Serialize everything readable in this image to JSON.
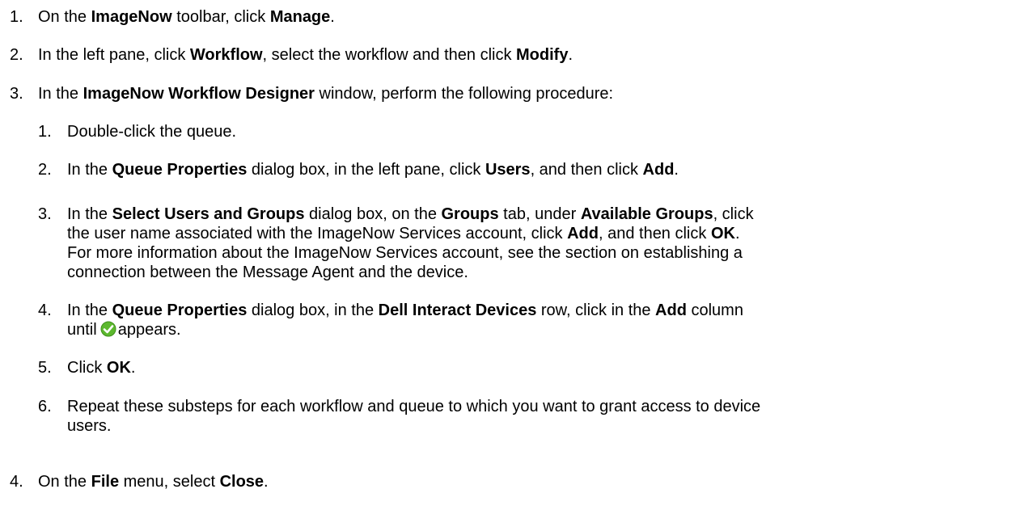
{
  "steps": [
    {
      "number": "1.",
      "parts": [
        "On the ",
        "ImageNow",
        " toolbar, click ",
        "Manage",
        "."
      ]
    },
    {
      "number": "2.",
      "parts": [
        "In the left pane, click ",
        "Workflow",
        ", select the workflow and then click ",
        "Modify",
        "."
      ]
    },
    {
      "number": "3.",
      "parts": [
        "In the ",
        "ImageNow Workflow Designer",
        " window, perform the following procedure:"
      ],
      "substeps": [
        {
          "number": "1.",
          "parts": [
            "Double-click the queue."
          ]
        },
        {
          "number": "2.",
          "parts": [
            "In the ",
            "Queue Properties",
            " dialog box, in the left pane, click ",
            "Users",
            ", and then click ",
            "Add",
            "."
          ]
        },
        {
          "number": "3.",
          "line1": [
            "In the ",
            "Select Users and Groups",
            " dialog box, on the ",
            "Groups",
            " tab, under ",
            "Available Groups",
            ", click"
          ],
          "line2": [
            "the user name associated with the ImageNow Services account, click ",
            "Add",
            ", and then click ",
            "OK",
            "."
          ],
          "line3": "For more information about the ImageNow Services account, see the section on establishing a",
          "line4": "connection between the Message Agent and the device."
        },
        {
          "number": "4.",
          "line1": [
            "In the ",
            "Queue Properties",
            " dialog box, in the ",
            "Dell Interact Devices",
            " row, click in the ",
            "Add",
            " column"
          ],
          "line2_before": "until",
          "line2_after": "appears.",
          "icon": "green-checkmark-icon"
        },
        {
          "number": "5.",
          "parts": [
            "Click ",
            "OK",
            "."
          ]
        },
        {
          "number": "6.",
          "line1": "Repeat these substeps for each workflow and queue to which you want to grant access to device",
          "line2": "users."
        }
      ]
    },
    {
      "number": "4.",
      "parts": [
        "On the ",
        "File",
        " menu, select ",
        "Close",
        "."
      ]
    }
  ],
  "colors": {
    "text": "#000000",
    "check_fill": "#5cb82e",
    "check_mark": "#ffffff"
  }
}
